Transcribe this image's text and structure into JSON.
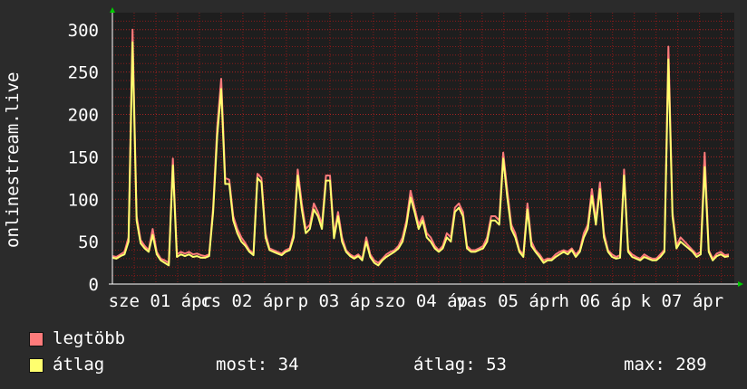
{
  "chart_data": {
    "type": "line",
    "ylabel": "onlinestream.live",
    "ylim": [
      0,
      320
    ],
    "yticks": [
      0,
      50,
      100,
      150,
      200,
      250,
      300
    ],
    "x_tick_labels": [
      "sze 01 ápr",
      "csü 02 ápr",
      "pén 03 ápr",
      "szo 04 ápr",
      "vas 05 ápr",
      "hét 06 ápr",
      "kedd 07 ápr"
    ],
    "x_tick_visible": [
      "sze 01 ápr",
      "cs 02 ápr",
      "p 03 áp",
      "szo 04 áp",
      "vas 05 ápr",
      "h 06 áp",
      "k 07 ápr"
    ],
    "grid": true,
    "colors": {
      "max": "#ff7b7b",
      "avg": "#ffff6e",
      "grid": "#8a1a1a",
      "axis": "#ffffff",
      "plot_bg": "#1e1e1e",
      "arrow": "#00cc00"
    },
    "series": [
      {
        "name": "legtöbb",
        "values": [
          33,
          32,
          35,
          38,
          55,
          300,
          80,
          52,
          45,
          40,
          65,
          38,
          30,
          28,
          25,
          148,
          35,
          38,
          36,
          38,
          35,
          36,
          34,
          33,
          35,
          90,
          185,
          242,
          125,
          123,
          80,
          65,
          55,
          48,
          40,
          36,
          130,
          125,
          60,
          42,
          40,
          38,
          36,
          40,
          42,
          60,
          135,
          95,
          65,
          70,
          95,
          85,
          70,
          128,
          128,
          58,
          85,
          55,
          40,
          35,
          32,
          35,
          30,
          55,
          35,
          28,
          25,
          30,
          35,
          38,
          40,
          45,
          55,
          75,
          110,
          90,
          70,
          80,
          60,
          55,
          45,
          40,
          45,
          60,
          55,
          90,
          95,
          85,
          45,
          40,
          40,
          42,
          45,
          55,
          80,
          80,
          75,
          155,
          110,
          70,
          60,
          40,
          35,
          95,
          50,
          40,
          35,
          28,
          30,
          30,
          35,
          38,
          40,
          38,
          42,
          35,
          40,
          60,
          70,
          112,
          75,
          120,
          60,
          40,
          35,
          32,
          34,
          135,
          40,
          35,
          32,
          30,
          35,
          32,
          30,
          30,
          35,
          40,
          280,
          85,
          45,
          55,
          50,
          45,
          40,
          35,
          38,
          155,
          40,
          30,
          36,
          38,
          34,
          35
        ],
        "unit": ""
      },
      {
        "name": "átlag",
        "values": [
          31,
          30,
          33,
          35,
          50,
          285,
          75,
          48,
          42,
          38,
          58,
          35,
          28,
          25,
          22,
          140,
          32,
          35,
          33,
          35,
          32,
          33,
          31,
          31,
          33,
          85,
          175,
          230,
          118,
          118,
          75,
          60,
          50,
          45,
          38,
          34,
          125,
          120,
          55,
          40,
          38,
          36,
          34,
          38,
          40,
          55,
          128,
          88,
          60,
          65,
          88,
          80,
          65,
          122,
          122,
          54,
          80,
          50,
          38,
          33,
          30,
          33,
          28,
          50,
          32,
          25,
          22,
          28,
          32,
          35,
          38,
          42,
          50,
          70,
          102,
          85,
          65,
          75,
          55,
          50,
          42,
          38,
          42,
          55,
          50,
          85,
          90,
          80,
          42,
          38,
          38,
          40,
          42,
          50,
          75,
          75,
          70,
          148,
          102,
          65,
          55,
          38,
          32,
          88,
          45,
          38,
          32,
          25,
          28,
          28,
          32,
          35,
          38,
          35,
          40,
          32,
          38,
          55,
          65,
          104,
          70,
          112,
          55,
          38,
          32,
          30,
          31,
          128,
          38,
          32,
          30,
          28,
          32,
          30,
          28,
          28,
          32,
          38,
          265,
          80,
          42,
          50,
          46,
          42,
          38,
          32,
          35,
          138,
          38,
          28,
          33,
          35,
          32,
          33
        ]
      }
    ],
    "legend": [
      {
        "label": "legtöbb",
        "color": "#ff7b7b"
      },
      {
        "label": "átlag",
        "color": "#ffff6e"
      }
    ],
    "stats": {
      "now": "most: 34",
      "avg": "átlag: 53",
      "max": "max: 289"
    }
  }
}
